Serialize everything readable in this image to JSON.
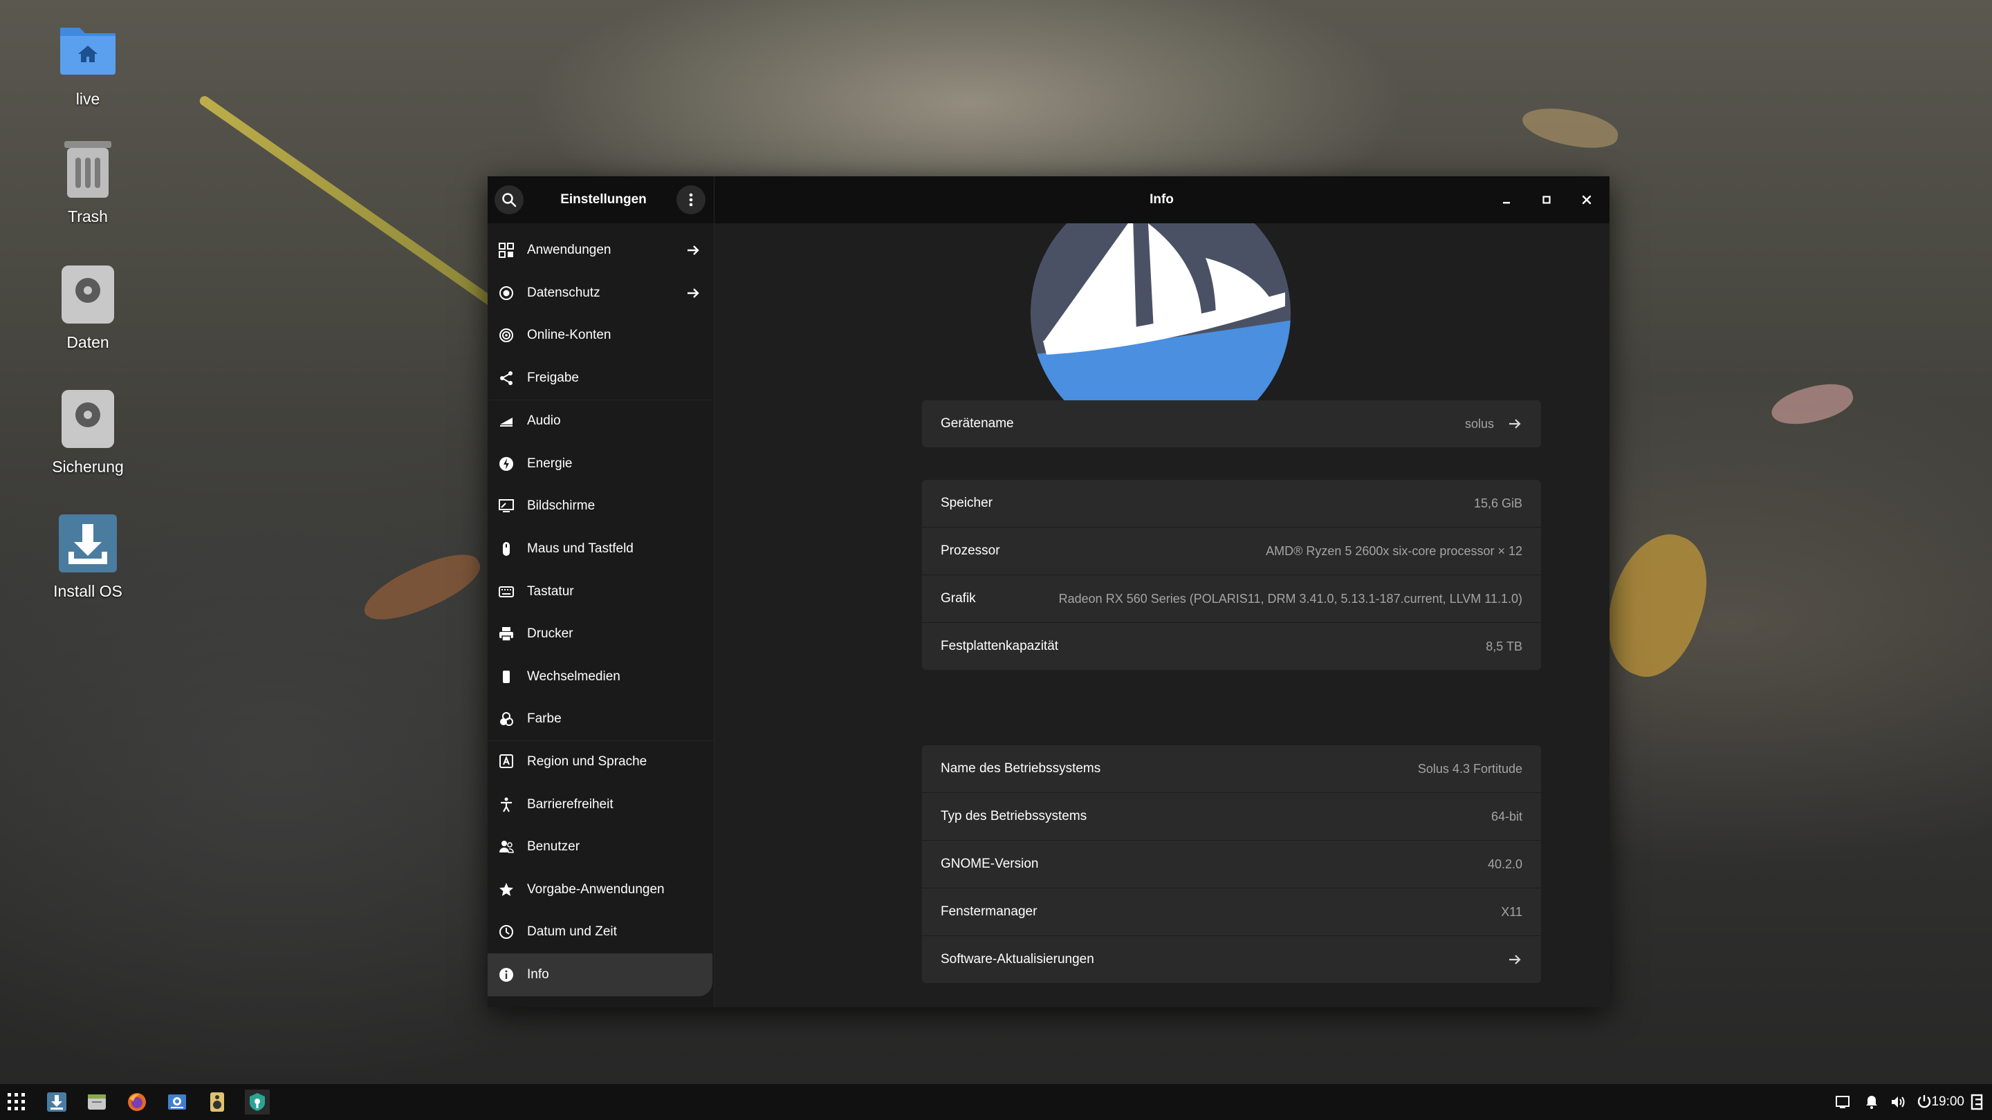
{
  "desktop": {
    "icons": [
      {
        "label": "live"
      },
      {
        "label": "Trash"
      },
      {
        "label": "Daten"
      },
      {
        "label": "Sicherung"
      },
      {
        "label": "Install OS"
      }
    ]
  },
  "window": {
    "sidebar_title": "Einstellungen",
    "page_title": "Info"
  },
  "sidebar": {
    "items": [
      {
        "label": "Anwendungen"
      },
      {
        "label": "Datenschutz"
      },
      {
        "label": "Online-Konten"
      },
      {
        "label": "Freigabe"
      },
      {
        "label": "Audio"
      },
      {
        "label": "Energie"
      },
      {
        "label": "Bildschirme"
      },
      {
        "label": "Maus und Tastfeld"
      },
      {
        "label": "Tastatur"
      },
      {
        "label": "Drucker"
      },
      {
        "label": "Wechselmedien"
      },
      {
        "label": "Farbe"
      },
      {
        "label": "Region und Sprache"
      },
      {
        "label": "Barrierefreiheit"
      },
      {
        "label": "Benutzer"
      },
      {
        "label": "Vorgabe-Anwendungen"
      },
      {
        "label": "Datum und Zeit"
      },
      {
        "label": "Info"
      }
    ]
  },
  "device": {
    "name_label": "Gerätename",
    "name_value": "solus"
  },
  "hardware": {
    "memory_label": "Speicher",
    "memory_value": "15,6 GiB",
    "processor_label": "Prozessor",
    "processor_value": "AMD® Ryzen 5 2600x six-core processor × 12",
    "graphics_label": "Grafik",
    "graphics_value": "Radeon RX 560 Series (POLARIS11, DRM 3.41.0, 5.13.1-187.current, LLVM 11.1.0)",
    "disk_label": "Festplattenkapazität",
    "disk_value": "8,5 TB"
  },
  "os": {
    "os_name_label": "Name des Betriebssystems",
    "os_name_value": "Solus 4.3 Fortitude",
    "os_type_label": "Typ des Betriebssystems",
    "os_type_value": "64-bit",
    "gnome_label": "GNOME-Version",
    "gnome_value": "40.2.0",
    "wm_label": "Fenstermanager",
    "wm_value": "X11",
    "updates_label": "Software-Aktualisierungen"
  },
  "taskbar": {
    "clock": "19:00"
  },
  "colors": {
    "accent_blue": "#4a8fe0",
    "folder_blue": "#3f8ae0",
    "solus_logo_dark": "#4b5165"
  }
}
